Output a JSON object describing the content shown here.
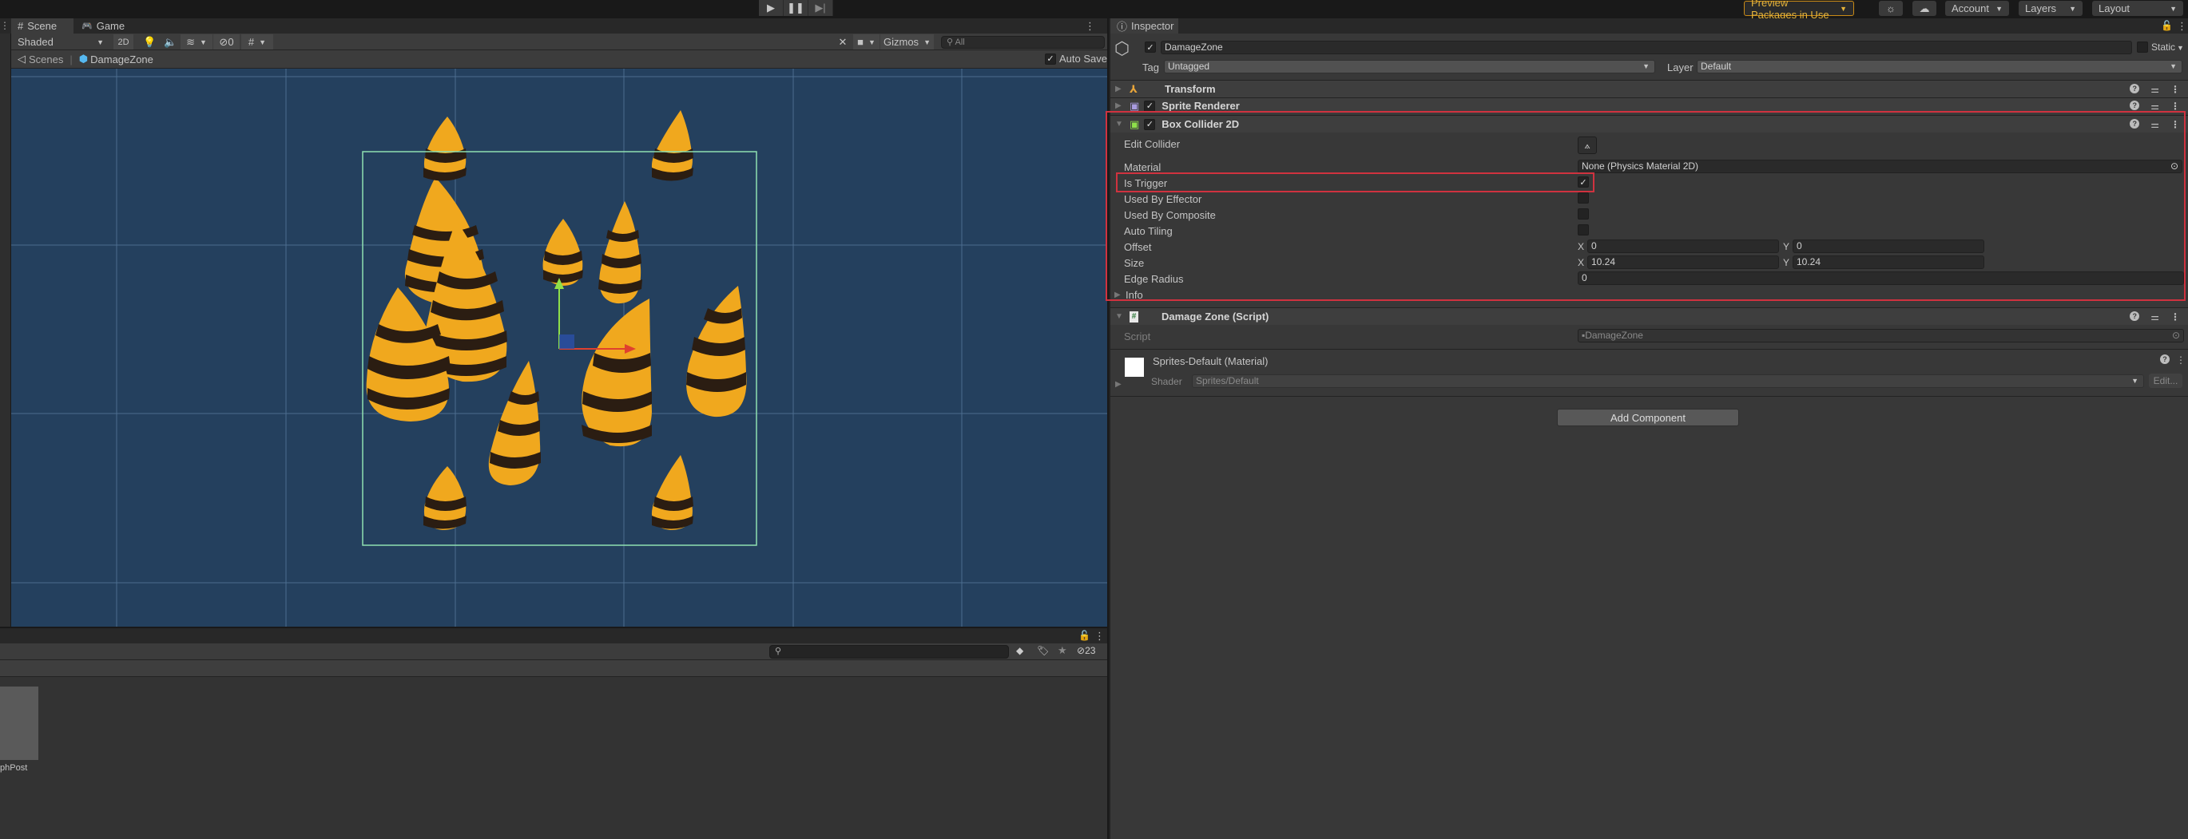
{
  "topbar": {
    "play_icon": "play-icon",
    "pause_icon": "pause-icon",
    "step_icon": "step-icon",
    "preview_packages_label": "Preview Packages in Use",
    "account_label": "Account",
    "layers_label": "Layers",
    "layout_label": "Layout"
  },
  "scene": {
    "tabs": [
      {
        "label": "Scene",
        "icon": "hash-icon"
      },
      {
        "label": "Game",
        "icon": "gamepad-icon"
      }
    ],
    "shading_mode": "Shaded",
    "toggle_2d": "2D",
    "hidden_count": "0",
    "gizmos_label": "Gizmos",
    "search_placeholder": "All",
    "auto_save_label": "Auto Save",
    "auto_save_checked": true,
    "breadcrumb": [
      "Scenes",
      "DamageZone"
    ],
    "colors": {
      "background": "#24405e",
      "collider": "#8fe0b0",
      "grid": "#4a6a8a"
    }
  },
  "project": {
    "hidden_count": "23",
    "asset_label": "phPost"
  },
  "inspector": {
    "tab_label": "Inspector",
    "object_name": "DamageZone",
    "object_active": true,
    "static_label": "Static",
    "tag_label": "Tag",
    "tag_value": "Untagged",
    "layer_label": "Layer",
    "layer_value": "Default",
    "components": {
      "transform": {
        "title": "Transform"
      },
      "sprite_renderer": {
        "title": "Sprite Renderer",
        "enabled": true
      },
      "box_collider": {
        "title": "Box Collider 2D",
        "enabled": true,
        "edit_collider_label": "Edit Collider",
        "material_label": "Material",
        "material_value": "None (Physics Material 2D)",
        "is_trigger_label": "Is Trigger",
        "is_trigger": true,
        "used_by_effector_label": "Used By Effector",
        "used_by_effector": false,
        "used_by_composite_label": "Used By Composite",
        "used_by_composite": false,
        "auto_tiling_label": "Auto Tiling",
        "auto_tiling": false,
        "offset_label": "Offset",
        "offset_x": "0",
        "offset_y": "0",
        "size_label": "Size",
        "size_x": "10.24",
        "size_y": "10.24",
        "edge_radius_label": "Edge Radius",
        "edge_radius": "0",
        "info_label": "Info"
      },
      "damage_zone": {
        "title": "Damage Zone (Script)",
        "script_label": "Script",
        "script_value": "DamageZone"
      },
      "material": {
        "title": "Sprites-Default (Material)",
        "shader_label": "Shader",
        "shader_value": "Sprites/Default",
        "edit_label": "Edit..."
      }
    },
    "add_component_label": "Add Component",
    "axis_x": "X",
    "axis_y": "Y",
    "highlight_color": "#d0323f"
  }
}
